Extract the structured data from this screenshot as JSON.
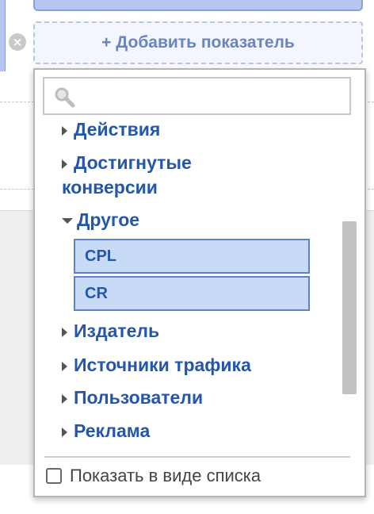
{
  "toolbar": {
    "add_metric_label": "+ Добавить показатель",
    "remove_glyph": "×"
  },
  "picker": {
    "search": {
      "value": "",
      "placeholder": ""
    },
    "groups": [
      {
        "label": "Действия",
        "expanded": false
      },
      {
        "label_line1": "Достигнутые",
        "label_line2": "конверсии",
        "expanded": false
      },
      {
        "label": "Другое",
        "expanded": true,
        "items": [
          "CPL",
          "CR"
        ]
      },
      {
        "label": "Издатель",
        "expanded": false
      },
      {
        "label": "Источники трафика",
        "expanded": false
      },
      {
        "label": "Пользователи",
        "expanded": false
      },
      {
        "label": "Реклама",
        "expanded": false
      }
    ],
    "list_view_checkbox": {
      "label": "Показать в виде списка",
      "checked": false
    }
  },
  "colors": {
    "group_text": "#2456a9",
    "selected_bg": "#c7dbf7",
    "selected_border": "#5f81c6",
    "accent_dashed": "#b8c4e6"
  }
}
